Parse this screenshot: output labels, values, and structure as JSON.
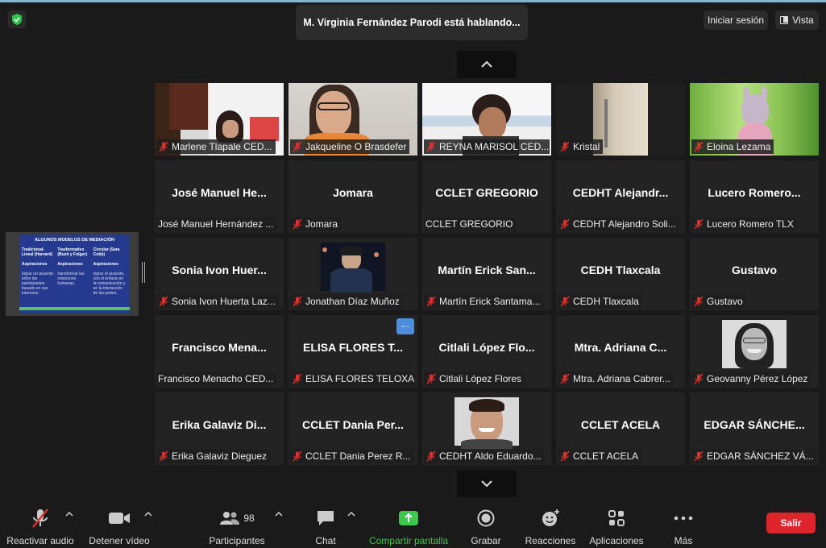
{
  "speaking_banner": "M. Virginia Fernández Parodi está hablando...",
  "header": {
    "signin_label": "Iniciar sesión",
    "view_label": "Vista"
  },
  "shared_slide": {
    "title": "ALGUNOS MODELOS DE MEDIACIÓN",
    "columns": [
      {
        "heading": "Tradicional-Lineal (Harvard)",
        "sub": "Aspiraciones",
        "text": "lograr un acuerdo entre los participantes basado en sus intereses."
      },
      {
        "heading": "Trasformativo (Bush y Folger)",
        "sub": "Aspiraciones",
        "text": "transformar las relaciones humanas."
      },
      {
        "heading": "Circular (Sara Cobb)",
        "sub": "Aspiraciones",
        "text": "lograr el acuerdo, con el énfasis en la comunicación y en la interacción de las partes."
      }
    ]
  },
  "participants": [
    {
      "name": "",
      "label": "Marlene Tlapale CED...",
      "video": "marlene"
    },
    {
      "name": "",
      "label": "Jakqueline O Brasdefer",
      "video": "jakqueline"
    },
    {
      "name": "",
      "label": "REYNA MARISOL CED...",
      "video": "reyna"
    },
    {
      "name": "",
      "label": "Kristal",
      "video": "kristal"
    },
    {
      "name": "",
      "label": "Eloina Lezama",
      "video": "eloina"
    },
    {
      "name": "José Manuel He...",
      "label": "José Manuel Hernández ...",
      "muted": false
    },
    {
      "name": "Jomara",
      "label": "Jomara"
    },
    {
      "name": "CCLET GREGORIO",
      "label": "CCLET GREGORIO",
      "muted": false
    },
    {
      "name": "CEDHT  Alejandr...",
      "label": "CEDHT Alejandro Soli..."
    },
    {
      "name": "Lucero  Romero...",
      "label": "Lucero Romero TLX"
    },
    {
      "name": "Sonia  Ivon  Huer...",
      "label": "Sonia Ivon Huerta Laz..."
    },
    {
      "name": "",
      "label": "Jonathan Díaz Muñoz",
      "video": "jonathan"
    },
    {
      "name": "Martín  Erick  San...",
      "label": "Martín Erick Santama..."
    },
    {
      "name": "CEDH Tlaxcala",
      "label": "CEDH Tlaxcala"
    },
    {
      "name": "Gustavo",
      "label": "Gustavo"
    },
    {
      "name": "Francisco  Mena...",
      "label": "Francisco Menacho CED...",
      "muted": false
    },
    {
      "name": "ELISA FLORES T...",
      "label": "ELISA FLORES TELOXA",
      "more": "..."
    },
    {
      "name": "Citlali  López  Flo...",
      "label": "Citlali López Flores"
    },
    {
      "name": "Mtra.  Adriana  C...",
      "label": "Mtra. Adriana Cabrer..."
    },
    {
      "name": "",
      "label": "Geovanny Pérez López",
      "video": "geovanny"
    },
    {
      "name": "Erika  Galaviz  Di...",
      "label": "Erika Galaviz Dieguez"
    },
    {
      "name": "CCLET  Dania  Per...",
      "label": "CCLET Dania Perez R..."
    },
    {
      "name": "",
      "label": "CEDHT Aldo Eduardo...",
      "video": "aldo"
    },
    {
      "name": "CCLET ACELA",
      "label": "CCLET ACELA"
    },
    {
      "name": "EDGAR  SÁNCHE...",
      "label": "EDGAR SÁNCHEZ VÁ..."
    }
  ],
  "toolbar": {
    "audio": "Reactivar audio",
    "video": "Detener vídeo",
    "participants": "Participantes",
    "participants_count": "98",
    "chat": "Chat",
    "share": "Compartir pantalla",
    "record": "Grabar",
    "reactions": "Reacciones",
    "apps": "Aplicaciones",
    "more": "Más",
    "leave": "Salir"
  },
  "colors": {
    "share_green": "#3cc84a",
    "leave_red": "#e0242c",
    "muted_red": "#e0302c",
    "more_blue": "#4e8ce0"
  }
}
